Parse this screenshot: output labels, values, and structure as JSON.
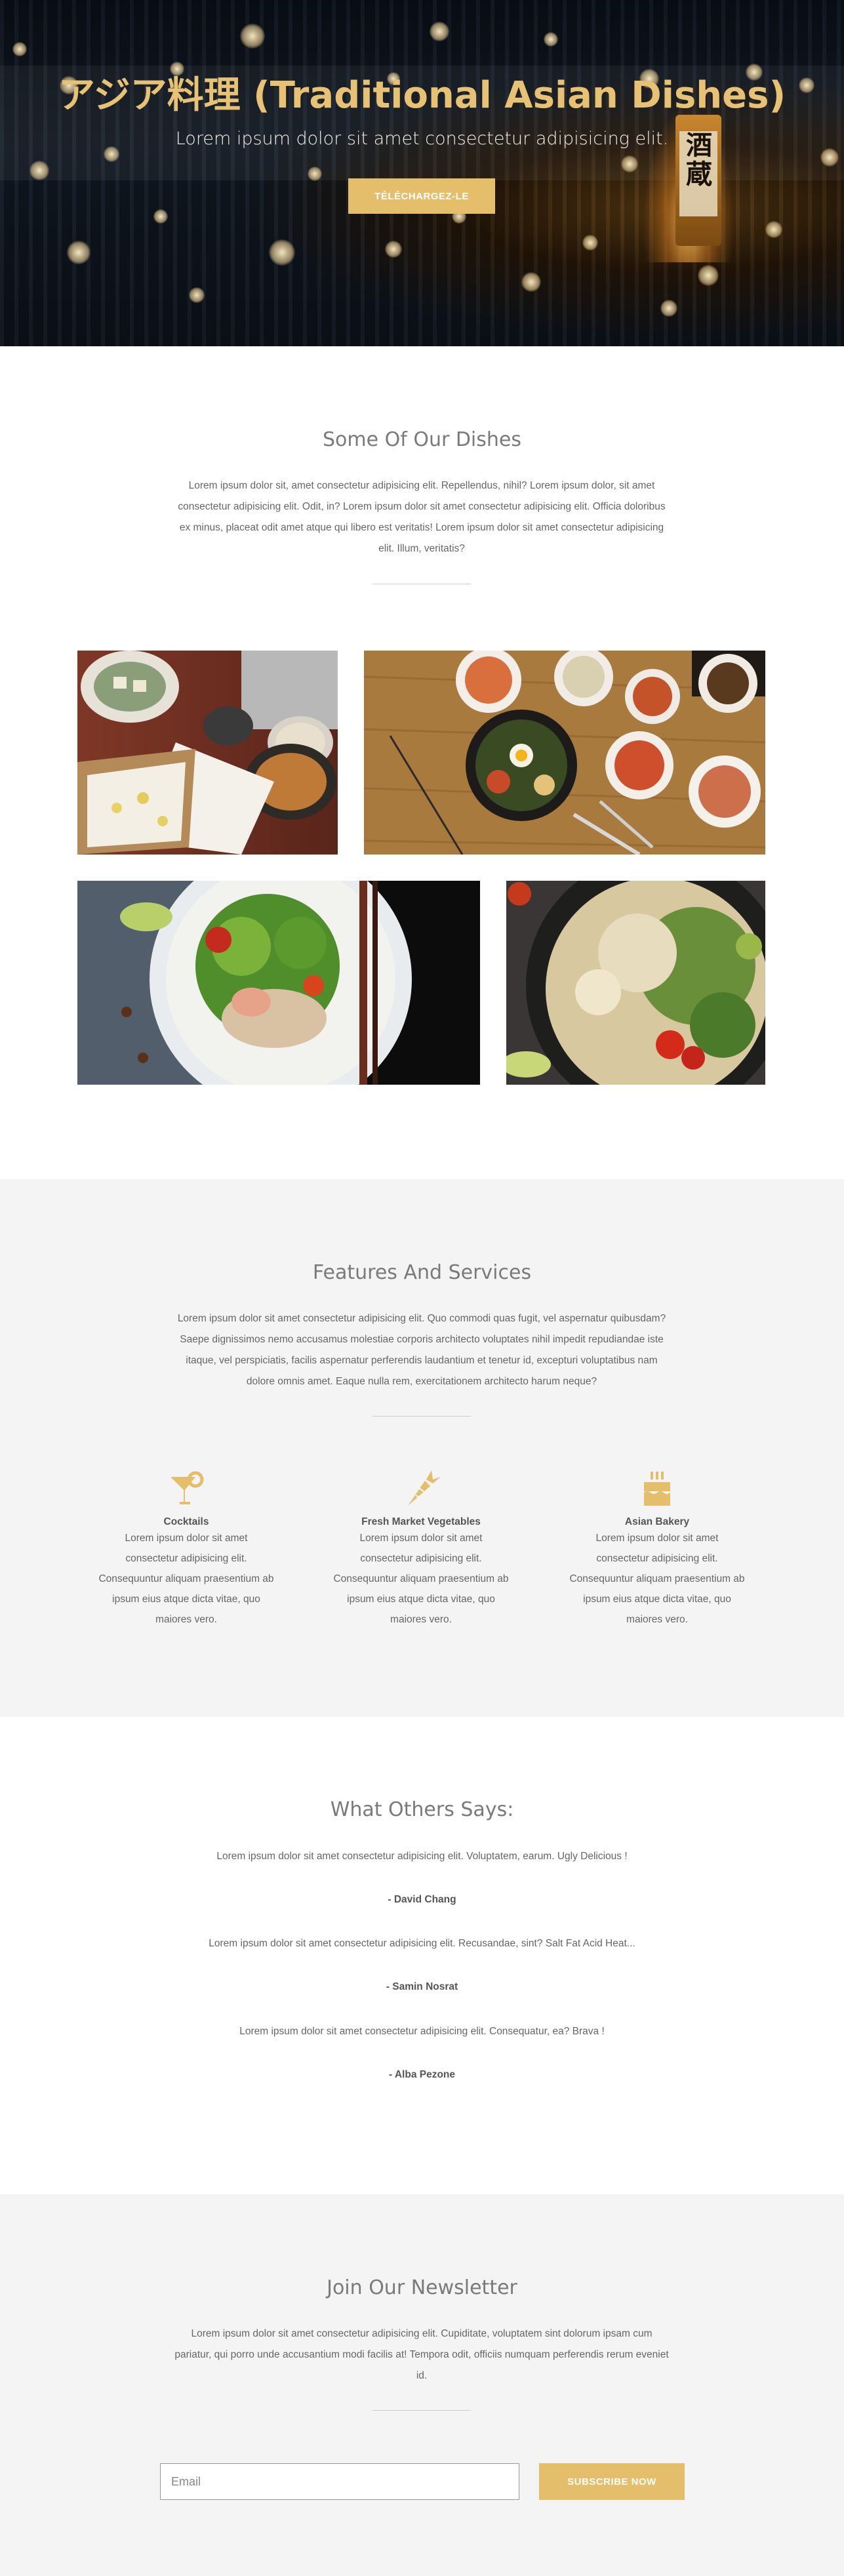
{
  "hero": {
    "title": "アジア料理 (Traditional Asian Dishes)",
    "subtitle": "Lorem ipsum dolor sit amet consectetur adipisicing elit.",
    "button_label": "TÉLÉCHARGEZ-LE",
    "bottle_text": "酒蔵"
  },
  "dishes": {
    "title": "Some Of Our Dishes",
    "description": "Lorem ipsum dolor sit, amet consectetur adipisicing elit. Repellendus, nihil? Lorem ipsum dolor, sit amet consectetur adipisicing elit. Odit, in? Lorem ipsum dolor sit amet consectetur adipisicing elit. Officia doloribus ex minus, placeat odit amet atque qui libero est veritatis! Lorem ipsum dolor sit amet consectetur adipisicing elit. Illum, veritatis?",
    "images": [
      "japanese-set-meal",
      "korean-bibimbap",
      "chicken-salad-bowl",
      "noodle-salad-bowl"
    ]
  },
  "features": {
    "title": "Features And Services",
    "description": "Lorem ipsum dolor sit amet consectetur adipisicing elit. Quo commodi quas fugit, vel aspernatur quibusdam? Saepe dignissimos nemo accusamus molestiae corporis architecto voluptates nihil impedit repudiandae iste itaque, vel perspiciatis, facilis aspernatur perferendis laudantium et tenetur id, excepturi voluptatibus nam dolore omnis amet. Eaque nulla rem, exercitationem architecto harum neque?",
    "items": [
      {
        "icon": "cocktail-icon",
        "title": "Cocktails",
        "text": "Lorem ipsum dolor sit amet consectetur adipisicing elit. Consequuntur aliquam praesentium ab ipsum eius atque dicta vitae, quo maiores vero."
      },
      {
        "icon": "carrot-icon",
        "title": "Fresh Market Vegetables",
        "text": "Lorem ipsum dolor sit amet consectetur adipisicing elit. Consequuntur aliquam praesentium ab ipsum eius atque dicta vitae, quo maiores vero."
      },
      {
        "icon": "birthday-cake-icon",
        "title": "Asian Bakery",
        "text": "Lorem ipsum dolor sit amet consectetur adipisicing elit. Consequuntur aliquam praesentium ab ipsum eius atque dicta vitae, quo maiores vero."
      }
    ]
  },
  "testimonials": {
    "title": "What Others Says:",
    "items": [
      {
        "quote": "Lorem ipsum dolor sit amet consectetur adipisicing elit. Voluptatem, earum. Ugly Delicious !",
        "author": "- David Chang"
      },
      {
        "quote": "Lorem ipsum dolor sit amet consectetur adipisicing elit. Recusandae, sint? Salt Fat Acid Heat...",
        "author": "- Samin Nosrat"
      },
      {
        "quote": "Lorem ipsum dolor sit amet consectetur adipisicing elit. Consequatur, ea? Brava !",
        "author": "- Alba Pezone"
      }
    ]
  },
  "newsletter": {
    "title": "Join Our Newsletter",
    "description": "Lorem ipsum dolor sit amet consectetur adipisicing elit. Cupiditate, voluptatem sint dolorum ipsam cum pariatur, qui porro unde accusantium modi facilis at! Tempora odit, officiis numquam perferendis rerum eveniet id.",
    "email_placeholder": "Email",
    "button_label": "SUBSCRIBE NOW"
  },
  "colors": {
    "accent": "#e4be6a",
    "section_gray": "#f4f4f4",
    "heading_gray": "#7a7a7a"
  }
}
